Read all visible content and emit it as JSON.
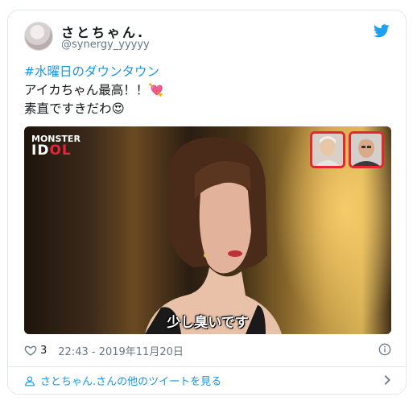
{
  "user": {
    "display_name": "さとちゃん.",
    "handle": "@synergy_yyyyy"
  },
  "tweet": {
    "hashtag": "#水曜日のダウンタウン",
    "line2": "アイカちゃん最高！！💘",
    "line3": "素直ですきだわ😍"
  },
  "media": {
    "logo_line1": "MONSTER",
    "logo_line2a": "ID",
    "logo_line2b": "OL",
    "subtitle": "少し臭いです"
  },
  "footer": {
    "like_count": "3",
    "timestamp": "22:43 - 2019年11月20日",
    "more_link": "さとちゃん.さんの他のツイートを見る"
  },
  "colors": {
    "link": "#1b95e0",
    "twitter_blue": "#1da1f2",
    "text": "#14171a",
    "muted": "#657786"
  },
  "icons": [
    "twitter-bird-icon",
    "heart-icon",
    "info-icon",
    "user-icon",
    "chevron-right-icon"
  ]
}
